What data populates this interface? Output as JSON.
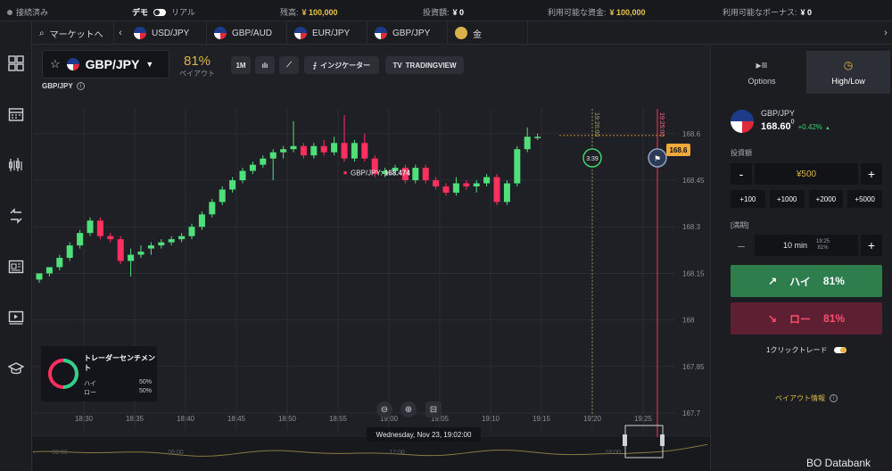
{
  "status": {
    "connection": "接続済み",
    "mode_demo": "デモ",
    "mode_real": "リアル",
    "balance_label": "残高:",
    "balance_value": "¥ 100,000",
    "invest_label": "投資額:",
    "invest_value": "¥ 0",
    "available_label": "利用可能な資金:",
    "available_value": "¥ 100,000",
    "bonus_label": "利用可能なボーナス:",
    "bonus_value": "¥ 0"
  },
  "tabs": {
    "market": "マーケットへ",
    "items": [
      "USD/JPY",
      "GBP/AUD",
      "EUR/JPY",
      "GBP/JPY",
      "金"
    ]
  },
  "chart_header": {
    "symbol": "GBP/JPY",
    "payout_pct": "81%",
    "payout_label": "ペイアウト",
    "timeframe": "1M",
    "indicators": "インジケーター",
    "tradingview": "TRADINGVIEW",
    "sub_symbol": "GBP/JPY"
  },
  "chart_data": {
    "type": "candlestick",
    "x_ticks": [
      "18:30",
      "18:35",
      "18:40",
      "18:45",
      "18:50",
      "18:55",
      "19:00",
      "19:05",
      "19:10",
      "19:15",
      "19:20",
      "19:25"
    ],
    "y_ticks": [
      168.6,
      168.45,
      168.3,
      168.15,
      168,
      167.85,
      167.7
    ],
    "ylim": [
      167.68,
      168.68
    ],
    "hover_label": "GBP/JPY:",
    "hover_value": "168.474",
    "current_price": "168.6",
    "candles": [
      [
        168.13,
        168.15,
        168.12,
        168.15
      ],
      [
        168.15,
        168.17,
        168.14,
        168.17
      ],
      [
        168.17,
        168.21,
        168.16,
        168.2
      ],
      [
        168.2,
        168.25,
        168.19,
        168.24
      ],
      [
        168.24,
        168.29,
        168.23,
        168.28
      ],
      [
        168.28,
        168.33,
        168.27,
        168.32
      ],
      [
        168.32,
        168.33,
        168.26,
        168.27
      ],
      [
        168.27,
        168.28,
        168.25,
        168.26
      ],
      [
        168.26,
        168.27,
        168.18,
        168.19
      ],
      [
        168.19,
        168.23,
        168.14,
        168.21
      ],
      [
        168.21,
        168.24,
        168.2,
        168.22
      ],
      [
        168.23,
        168.25,
        168.21,
        168.24
      ],
      [
        168.24,
        168.26,
        168.23,
        168.25
      ],
      [
        168.25,
        168.27,
        168.24,
        168.26
      ],
      [
        168.26,
        168.28,
        168.25,
        168.27
      ],
      [
        168.27,
        168.31,
        168.26,
        168.3
      ],
      [
        168.3,
        168.35,
        168.29,
        168.34
      ],
      [
        168.34,
        168.39,
        168.33,
        168.38
      ],
      [
        168.38,
        168.43,
        168.37,
        168.42
      ],
      [
        168.42,
        168.46,
        168.41,
        168.45
      ],
      [
        168.45,
        168.49,
        168.44,
        168.48
      ],
      [
        168.48,
        168.51,
        168.47,
        168.5
      ],
      [
        168.5,
        168.53,
        168.49,
        168.52
      ],
      [
        168.52,
        168.55,
        168.45,
        168.54
      ],
      [
        168.54,
        168.56,
        168.52,
        168.55
      ],
      [
        168.55,
        168.64,
        168.54,
        168.56
      ],
      [
        168.56,
        168.57,
        168.52,
        168.53
      ],
      [
        168.53,
        168.57,
        168.52,
        168.56
      ],
      [
        168.56,
        168.58,
        168.53,
        168.54
      ],
      [
        168.54,
        168.59,
        168.53,
        168.57
      ],
      [
        168.57,
        168.66,
        168.51,
        168.52
      ],
      [
        168.52,
        168.58,
        168.51,
        168.57
      ],
      [
        168.57,
        168.6,
        168.51,
        168.52
      ],
      [
        168.52,
        168.53,
        168.46,
        168.47
      ],
      [
        168.47,
        168.49,
        168.46,
        168.48
      ],
      [
        168.48,
        168.5,
        168.47,
        168.49
      ],
      [
        168.49,
        168.5,
        168.44,
        168.45
      ],
      [
        168.45,
        168.5,
        168.44,
        168.49
      ],
      [
        168.49,
        168.5,
        168.44,
        168.45
      ],
      [
        168.45,
        168.46,
        168.42,
        168.43
      ],
      [
        168.43,
        168.44,
        168.4,
        168.41
      ],
      [
        168.41,
        168.46,
        168.4,
        168.44
      ],
      [
        168.44,
        168.45,
        168.42,
        168.43
      ],
      [
        168.43,
        168.45,
        168.41,
        168.44
      ],
      [
        168.44,
        168.47,
        168.43,
        168.46
      ],
      [
        168.46,
        168.47,
        168.37,
        168.38
      ],
      [
        168.38,
        168.45,
        168.37,
        168.44
      ],
      [
        168.44,
        168.56,
        168.43,
        168.55
      ],
      [
        168.55,
        168.62,
        168.54,
        168.59
      ],
      [
        168.59,
        168.6,
        168.58,
        168.59
      ]
    ],
    "expiry_countdown": "3:39",
    "expiry_line_1": "19:20:00",
    "expiry_line_2": "19:25:00"
  },
  "sentiment": {
    "title": "トレーダーセンチメント",
    "high_label": "ハイ",
    "high_value": "50%",
    "low_label": "ロー",
    "low_value": "50%",
    "high_pct": 50
  },
  "timestamp": "Wednesday, Nov 23, 19:02:00",
  "mini_ticks": [
    "02:00",
    "06:00",
    "12:00",
    "18:00"
  ],
  "panel": {
    "tab_options": "Options",
    "tab_highlow": "High/Low",
    "asset": "GBP/JPY",
    "price": "168.60",
    "price_sup": "0",
    "change": "+0.42%",
    "invest_label": "投資額",
    "invest_value": "¥500",
    "quick_amounts": [
      "+100",
      "+1000",
      "+2000",
      "+5000"
    ],
    "expiry_label": "[満期]",
    "expiry_value": "10 min",
    "expiry_time": "19:25",
    "expiry_pct": "81%",
    "high_label": "ハイ",
    "high_pct": "81%",
    "low_label": "ロー",
    "low_pct": "81%",
    "oneclick": "1クリックトレード",
    "payout_info": "ペイアウト情報"
  },
  "watermark": "BO Databank",
  "colors": {
    "up": "#4fe07c",
    "down": "#ff2f5f",
    "accent": "#f2a93b"
  }
}
